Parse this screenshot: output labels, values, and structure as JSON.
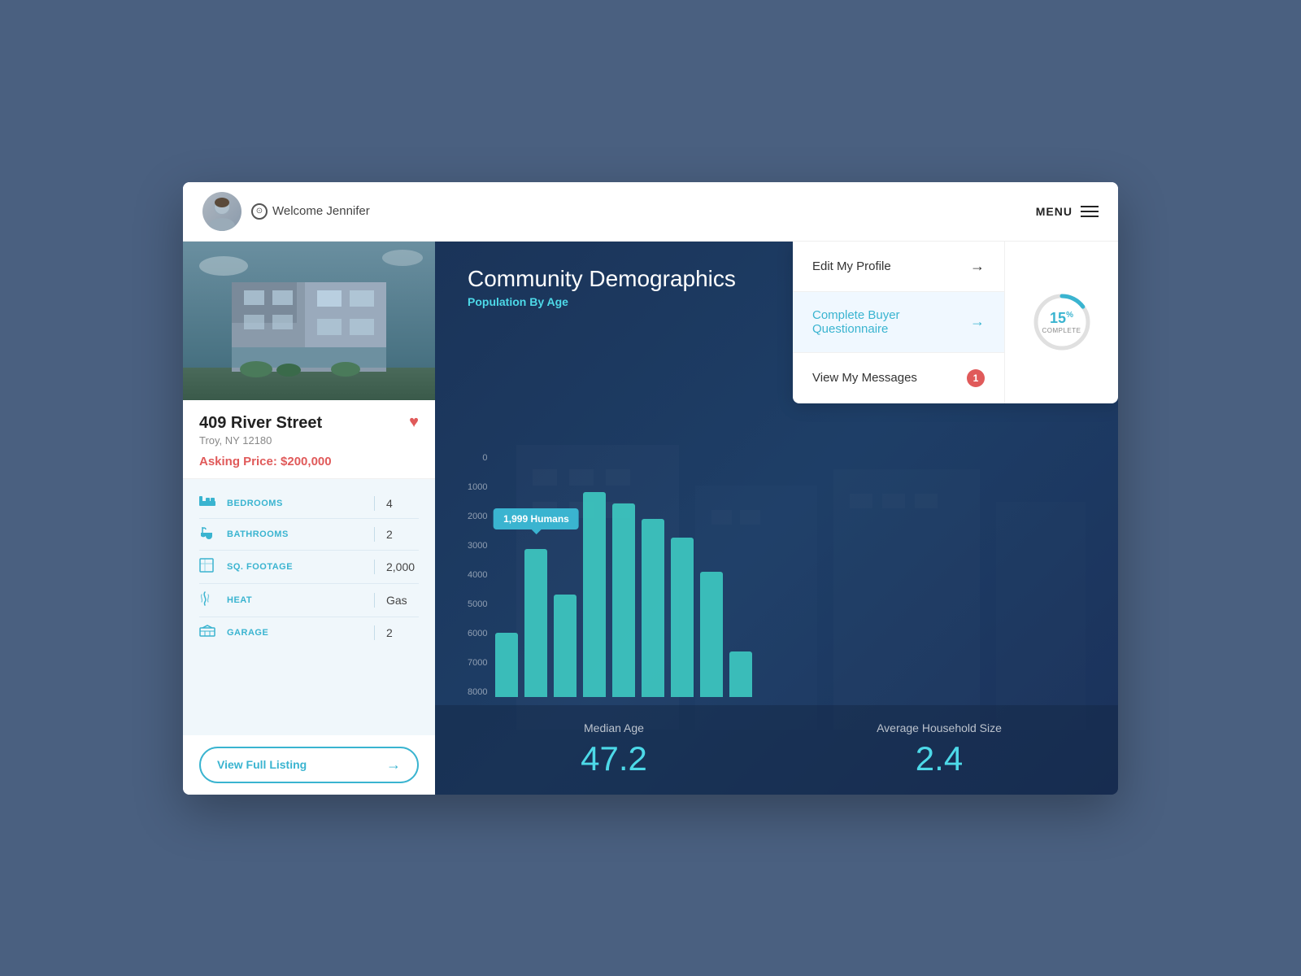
{
  "header": {
    "welcome_text": "Welcome Jennifer",
    "menu_label": "MENU"
  },
  "property": {
    "address": "409 River Street",
    "city_state": "Troy, NY 12180",
    "asking_price": "Asking Price: $200,000",
    "details": [
      {
        "icon": "bed",
        "label": "BEDROOMS",
        "value": "4"
      },
      {
        "icon": "bath",
        "label": "BATHROOMS",
        "value": "2"
      },
      {
        "icon": "sqft",
        "label": "SQ. FOOTAGE",
        "value": "2,000"
      },
      {
        "icon": "heat",
        "label": "HEAT",
        "value": "Gas"
      },
      {
        "icon": "garage",
        "label": "GARAGE",
        "value": "2"
      }
    ],
    "view_listing_btn": "View Full Listing"
  },
  "chart": {
    "title": "Community Demographics",
    "subtitle": "Population By Age",
    "y_labels": [
      "0",
      "1000",
      "2000",
      "3000",
      "4000",
      "5000",
      "6000",
      "7000",
      "8000"
    ],
    "bars": [
      {
        "height_pct": 28,
        "tooltip": null
      },
      {
        "height_pct": 65,
        "tooltip": "1,999 Humans"
      },
      {
        "height_pct": 45,
        "tooltip": null
      },
      {
        "height_pct": 90,
        "tooltip": null
      },
      {
        "height_pct": 85,
        "tooltip": null
      },
      {
        "height_pct": 78,
        "tooltip": null
      },
      {
        "height_pct": 70,
        "tooltip": null
      },
      {
        "height_pct": 55,
        "tooltip": null
      },
      {
        "height_pct": 20,
        "tooltip": null
      }
    ],
    "stats": [
      {
        "label": "Median Age",
        "value": "47.2"
      },
      {
        "label": "Average Household Size",
        "value": "2.4"
      }
    ]
  },
  "dropdown": {
    "items": [
      {
        "text": "Edit My Profile",
        "arrow": "→",
        "type": "normal",
        "badge": null
      },
      {
        "text": "Complete Buyer Questionnaire",
        "arrow": "→",
        "type": "blue",
        "badge": null
      },
      {
        "text": "View My Messages",
        "arrow": null,
        "type": "normal",
        "badge": "1"
      }
    ],
    "progress": {
      "percent": "15",
      "label": "COMPLETE"
    }
  }
}
